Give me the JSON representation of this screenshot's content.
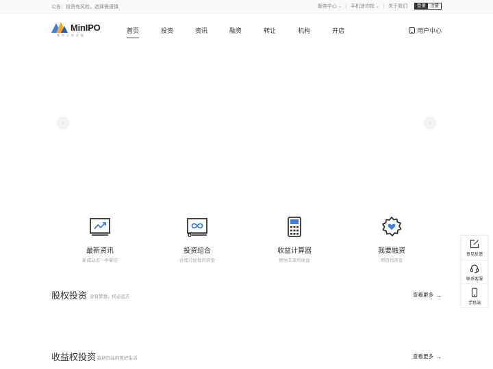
{
  "topbar": {
    "notice": "公告：投资有风险，选择需谨慎",
    "links": [
      {
        "label": "服务中心",
        "has_dropdown": true
      },
      {
        "label": "手机迷你投",
        "has_dropdown": true
      },
      {
        "label": "关于我们",
        "has_dropdown": false
      }
    ],
    "login": "登录",
    "register": "注册"
  },
  "header": {
    "logo_text": "MinIPO",
    "logo_sub": "看得见的金融",
    "nav": [
      "首页",
      "投资",
      "资讯",
      "融资",
      "转让",
      "机构",
      "开店"
    ],
    "active_nav": "首页",
    "user_center": "用户中心"
  },
  "banner": {
    "prev_arrow": "‹",
    "next_arrow": "›"
  },
  "features": [
    {
      "title": "最新资讯",
      "subtitle": "新闻动态一手掌控",
      "icon": "monitor-trend-icon"
    },
    {
      "title": "投资组合",
      "subtitle": "合理分配我的资金",
      "icon": "infinity-screen-icon"
    },
    {
      "title": "收益计算器",
      "subtitle": "预估未来的收益",
      "icon": "calculator-icon"
    },
    {
      "title": "我要融资",
      "subtitle": "项目找资金",
      "icon": "heart-gear-icon"
    }
  ],
  "sections": [
    {
      "title": "股权投资",
      "subtitle": "没有梦想，何必远方",
      "more": "查看更多"
    },
    {
      "title": "收益权投资",
      "subtitle": "我所向往的美好生活",
      "more": "查看更多"
    }
  ],
  "sidebar": [
    {
      "label": "意见反馈",
      "icon": "edit-icon"
    },
    {
      "label": "联系客服",
      "icon": "headset-icon"
    },
    {
      "label": "手机端",
      "icon": "phone-icon"
    }
  ],
  "colors": {
    "accent_blue": "#3b7de9",
    "logo_orange": "#f5a623",
    "text_dark": "#333333"
  }
}
